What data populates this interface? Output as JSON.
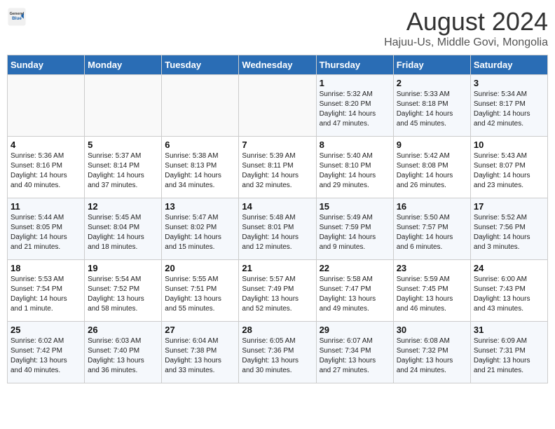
{
  "header": {
    "logo_line1": "General",
    "logo_line2": "Blue",
    "month_title": "August 2024",
    "subtitle": "Hajuu-Us, Middle Govi, Mongolia"
  },
  "days_of_week": [
    "Sunday",
    "Monday",
    "Tuesday",
    "Wednesday",
    "Thursday",
    "Friday",
    "Saturday"
  ],
  "weeks": [
    [
      {
        "day": "",
        "info": ""
      },
      {
        "day": "",
        "info": ""
      },
      {
        "day": "",
        "info": ""
      },
      {
        "day": "",
        "info": ""
      },
      {
        "day": "1",
        "info": "Sunrise: 5:32 AM\nSunset: 8:20 PM\nDaylight: 14 hours\nand 47 minutes."
      },
      {
        "day": "2",
        "info": "Sunrise: 5:33 AM\nSunset: 8:18 PM\nDaylight: 14 hours\nand 45 minutes."
      },
      {
        "day": "3",
        "info": "Sunrise: 5:34 AM\nSunset: 8:17 PM\nDaylight: 14 hours\nand 42 minutes."
      }
    ],
    [
      {
        "day": "4",
        "info": "Sunrise: 5:36 AM\nSunset: 8:16 PM\nDaylight: 14 hours\nand 40 minutes."
      },
      {
        "day": "5",
        "info": "Sunrise: 5:37 AM\nSunset: 8:14 PM\nDaylight: 14 hours\nand 37 minutes."
      },
      {
        "day": "6",
        "info": "Sunrise: 5:38 AM\nSunset: 8:13 PM\nDaylight: 14 hours\nand 34 minutes."
      },
      {
        "day": "7",
        "info": "Sunrise: 5:39 AM\nSunset: 8:11 PM\nDaylight: 14 hours\nand 32 minutes."
      },
      {
        "day": "8",
        "info": "Sunrise: 5:40 AM\nSunset: 8:10 PM\nDaylight: 14 hours\nand 29 minutes."
      },
      {
        "day": "9",
        "info": "Sunrise: 5:42 AM\nSunset: 8:08 PM\nDaylight: 14 hours\nand 26 minutes."
      },
      {
        "day": "10",
        "info": "Sunrise: 5:43 AM\nSunset: 8:07 PM\nDaylight: 14 hours\nand 23 minutes."
      }
    ],
    [
      {
        "day": "11",
        "info": "Sunrise: 5:44 AM\nSunset: 8:05 PM\nDaylight: 14 hours\nand 21 minutes."
      },
      {
        "day": "12",
        "info": "Sunrise: 5:45 AM\nSunset: 8:04 PM\nDaylight: 14 hours\nand 18 minutes."
      },
      {
        "day": "13",
        "info": "Sunrise: 5:47 AM\nSunset: 8:02 PM\nDaylight: 14 hours\nand 15 minutes."
      },
      {
        "day": "14",
        "info": "Sunrise: 5:48 AM\nSunset: 8:01 PM\nDaylight: 14 hours\nand 12 minutes."
      },
      {
        "day": "15",
        "info": "Sunrise: 5:49 AM\nSunset: 7:59 PM\nDaylight: 14 hours\nand 9 minutes."
      },
      {
        "day": "16",
        "info": "Sunrise: 5:50 AM\nSunset: 7:57 PM\nDaylight: 14 hours\nand 6 minutes."
      },
      {
        "day": "17",
        "info": "Sunrise: 5:52 AM\nSunset: 7:56 PM\nDaylight: 14 hours\nand 3 minutes."
      }
    ],
    [
      {
        "day": "18",
        "info": "Sunrise: 5:53 AM\nSunset: 7:54 PM\nDaylight: 14 hours\nand 1 minute."
      },
      {
        "day": "19",
        "info": "Sunrise: 5:54 AM\nSunset: 7:52 PM\nDaylight: 13 hours\nand 58 minutes."
      },
      {
        "day": "20",
        "info": "Sunrise: 5:55 AM\nSunset: 7:51 PM\nDaylight: 13 hours\nand 55 minutes."
      },
      {
        "day": "21",
        "info": "Sunrise: 5:57 AM\nSunset: 7:49 PM\nDaylight: 13 hours\nand 52 minutes."
      },
      {
        "day": "22",
        "info": "Sunrise: 5:58 AM\nSunset: 7:47 PM\nDaylight: 13 hours\nand 49 minutes."
      },
      {
        "day": "23",
        "info": "Sunrise: 5:59 AM\nSunset: 7:45 PM\nDaylight: 13 hours\nand 46 minutes."
      },
      {
        "day": "24",
        "info": "Sunrise: 6:00 AM\nSunset: 7:43 PM\nDaylight: 13 hours\nand 43 minutes."
      }
    ],
    [
      {
        "day": "25",
        "info": "Sunrise: 6:02 AM\nSunset: 7:42 PM\nDaylight: 13 hours\nand 40 minutes."
      },
      {
        "day": "26",
        "info": "Sunrise: 6:03 AM\nSunset: 7:40 PM\nDaylight: 13 hours\nand 36 minutes."
      },
      {
        "day": "27",
        "info": "Sunrise: 6:04 AM\nSunset: 7:38 PM\nDaylight: 13 hours\nand 33 minutes."
      },
      {
        "day": "28",
        "info": "Sunrise: 6:05 AM\nSunset: 7:36 PM\nDaylight: 13 hours\nand 30 minutes."
      },
      {
        "day": "29",
        "info": "Sunrise: 6:07 AM\nSunset: 7:34 PM\nDaylight: 13 hours\nand 27 minutes."
      },
      {
        "day": "30",
        "info": "Sunrise: 6:08 AM\nSunset: 7:32 PM\nDaylight: 13 hours\nand 24 minutes."
      },
      {
        "day": "31",
        "info": "Sunrise: 6:09 AM\nSunset: 7:31 PM\nDaylight: 13 hours\nand 21 minutes."
      }
    ]
  ]
}
